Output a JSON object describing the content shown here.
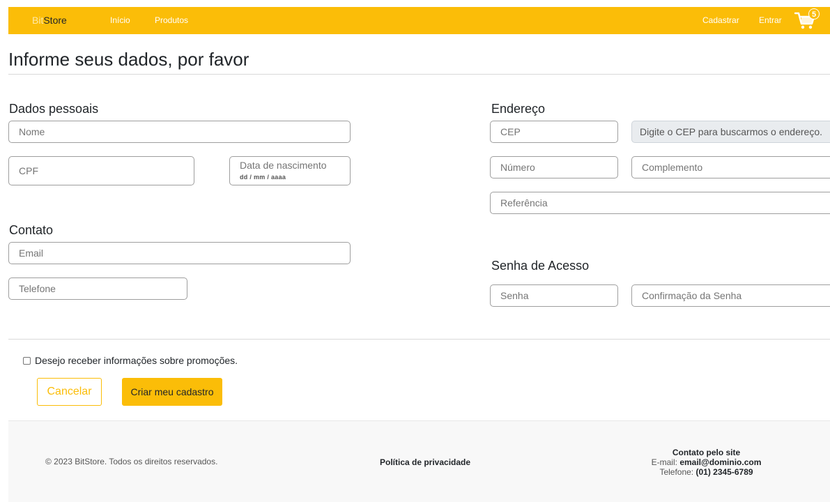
{
  "navbar": {
    "brand_prefix": "Bit",
    "brand_suffix": "Store",
    "links": [
      "Início",
      "Produtos"
    ],
    "register": "Cadastrar",
    "login": "Entrar",
    "cart_count": "5",
    "cart_icon": "shopping-cart-icon"
  },
  "page": {
    "title": "Informe seus dados, por favor"
  },
  "personal": {
    "title": "Dados pessoais",
    "name_placeholder": "Nome",
    "cpf_placeholder": "CPF",
    "birth_label": "Data de nascimento",
    "birth_format": "dd / mm / aaaa"
  },
  "contact": {
    "title": "Contato",
    "email_placeholder": "Email",
    "phone_placeholder": "Telefone"
  },
  "address": {
    "title": "Endereço",
    "cep_placeholder": "CEP",
    "cep_hint": "Digite o CEP para buscarmos o endereço.",
    "number_placeholder": "Número",
    "complement_placeholder": "Complemento",
    "reference_placeholder": "Referência"
  },
  "password": {
    "title": "Senha de Acesso",
    "password_placeholder": "Senha",
    "confirm_placeholder": "Confirmação da Senha"
  },
  "form": {
    "promo_label": "Desejo receber informações sobre promoções.",
    "cancel_label": "Cancelar",
    "submit_label": "Criar meu cadastro"
  },
  "footer": {
    "copyright": "© 2023 BitStore. Todos os direitos reservados.",
    "privacy": "Política de privacidade",
    "contact_title": "Contato pelo site",
    "email_label": "E-mail:",
    "email": "email@dominio.com",
    "phone_label": "Telefone:",
    "phone": "(01) 2345-6789"
  },
  "colors": {
    "accent": "#fbbd08"
  }
}
